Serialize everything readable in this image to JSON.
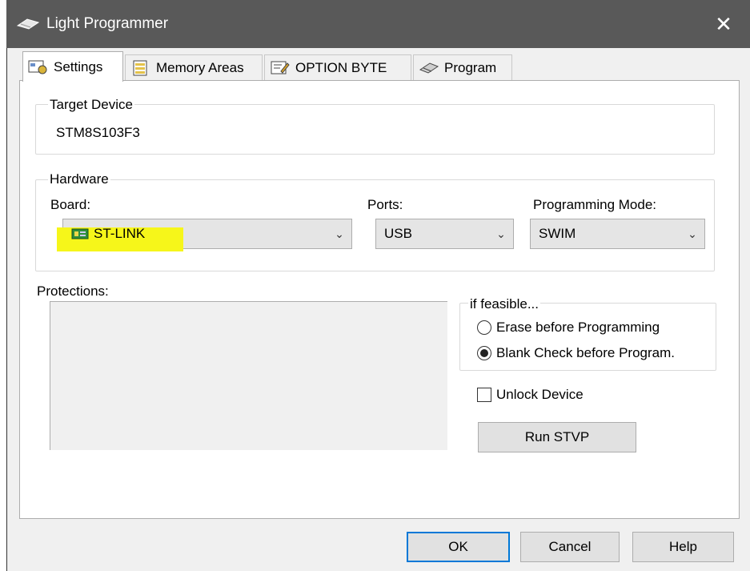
{
  "window": {
    "title": "Light Programmer",
    "close_label": "✕"
  },
  "tabs": [
    {
      "label": "Settings",
      "icon": "settings-icon"
    },
    {
      "label": "Memory Areas",
      "icon": "memory-icon"
    },
    {
      "label": "OPTION BYTE",
      "icon": "option-byte-icon"
    },
    {
      "label": "Program",
      "icon": "chip-icon"
    }
  ],
  "target": {
    "legend": "Target Device",
    "value": "STM8S103F3"
  },
  "hardware": {
    "legend": "Hardware",
    "board_label": "Board:",
    "board_value": "ST-LINK",
    "ports_label": "Ports:",
    "ports_value": "USB",
    "mode_label": "Programming Mode:",
    "mode_value": "SWIM",
    "highlight_color": "#f6f61a"
  },
  "protections": {
    "label": "Protections:"
  },
  "feasible": {
    "legend": "if feasible...",
    "erase_label": "Erase before Programming",
    "blank_label": "Blank Check before Program.",
    "selected": "blank"
  },
  "unlock": {
    "label": "Unlock Device",
    "checked": false
  },
  "buttons": {
    "run": "Run STVP",
    "ok": "OK",
    "cancel": "Cancel",
    "help": "Help"
  }
}
